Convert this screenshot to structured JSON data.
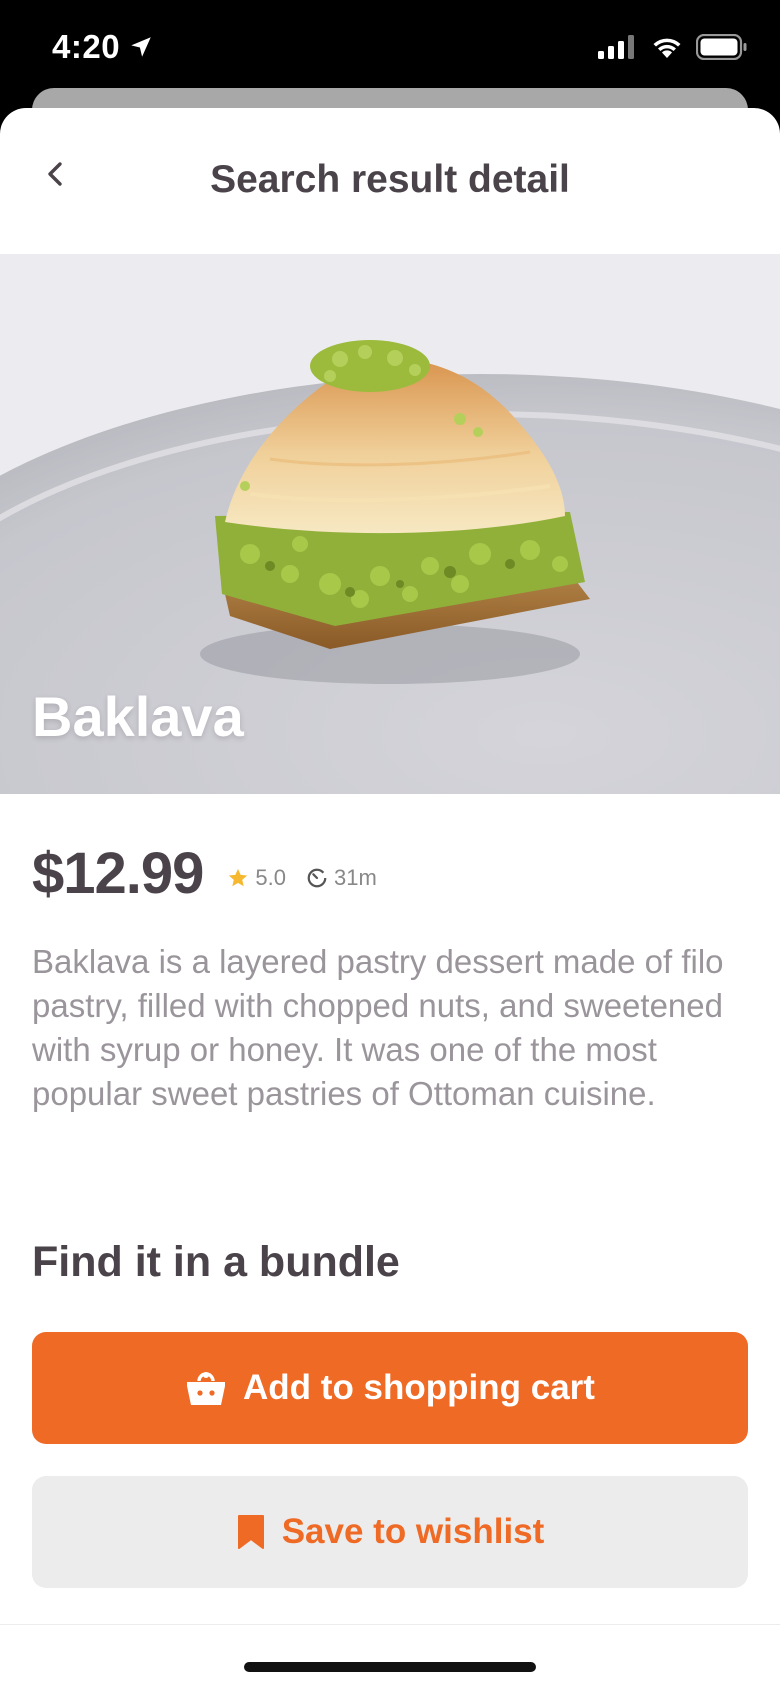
{
  "status_bar": {
    "time": "4:20",
    "icons": [
      "location-arrow-icon",
      "signal-icon",
      "wifi-icon",
      "battery-icon"
    ]
  },
  "nav": {
    "back_icon": "chevron-left-icon",
    "title": "Search result detail"
  },
  "product": {
    "name": "Baklava",
    "price": "$12.99",
    "rating": "5.0",
    "duration": "31m",
    "description": "Baklava is a layered pastry dessert made of filo pastry, filled with chopped nuts, and sweetened with syrup or honey. It was one of the most popular sweet pastries of Ottoman cuisine."
  },
  "bundle": {
    "heading": "Find it in a bundle"
  },
  "actions": {
    "add_to_cart_label": "Add to shopping cart",
    "add_to_cart_icon": "basket-icon",
    "save_label": "Save to wishlist",
    "save_icon": "bookmark-icon"
  },
  "colors": {
    "accent": "#ee6a25",
    "text_dark": "#4a4349",
    "text_muted": "#9a959b",
    "star": "#f5b82e",
    "secondary_button_bg": "#ececed"
  }
}
